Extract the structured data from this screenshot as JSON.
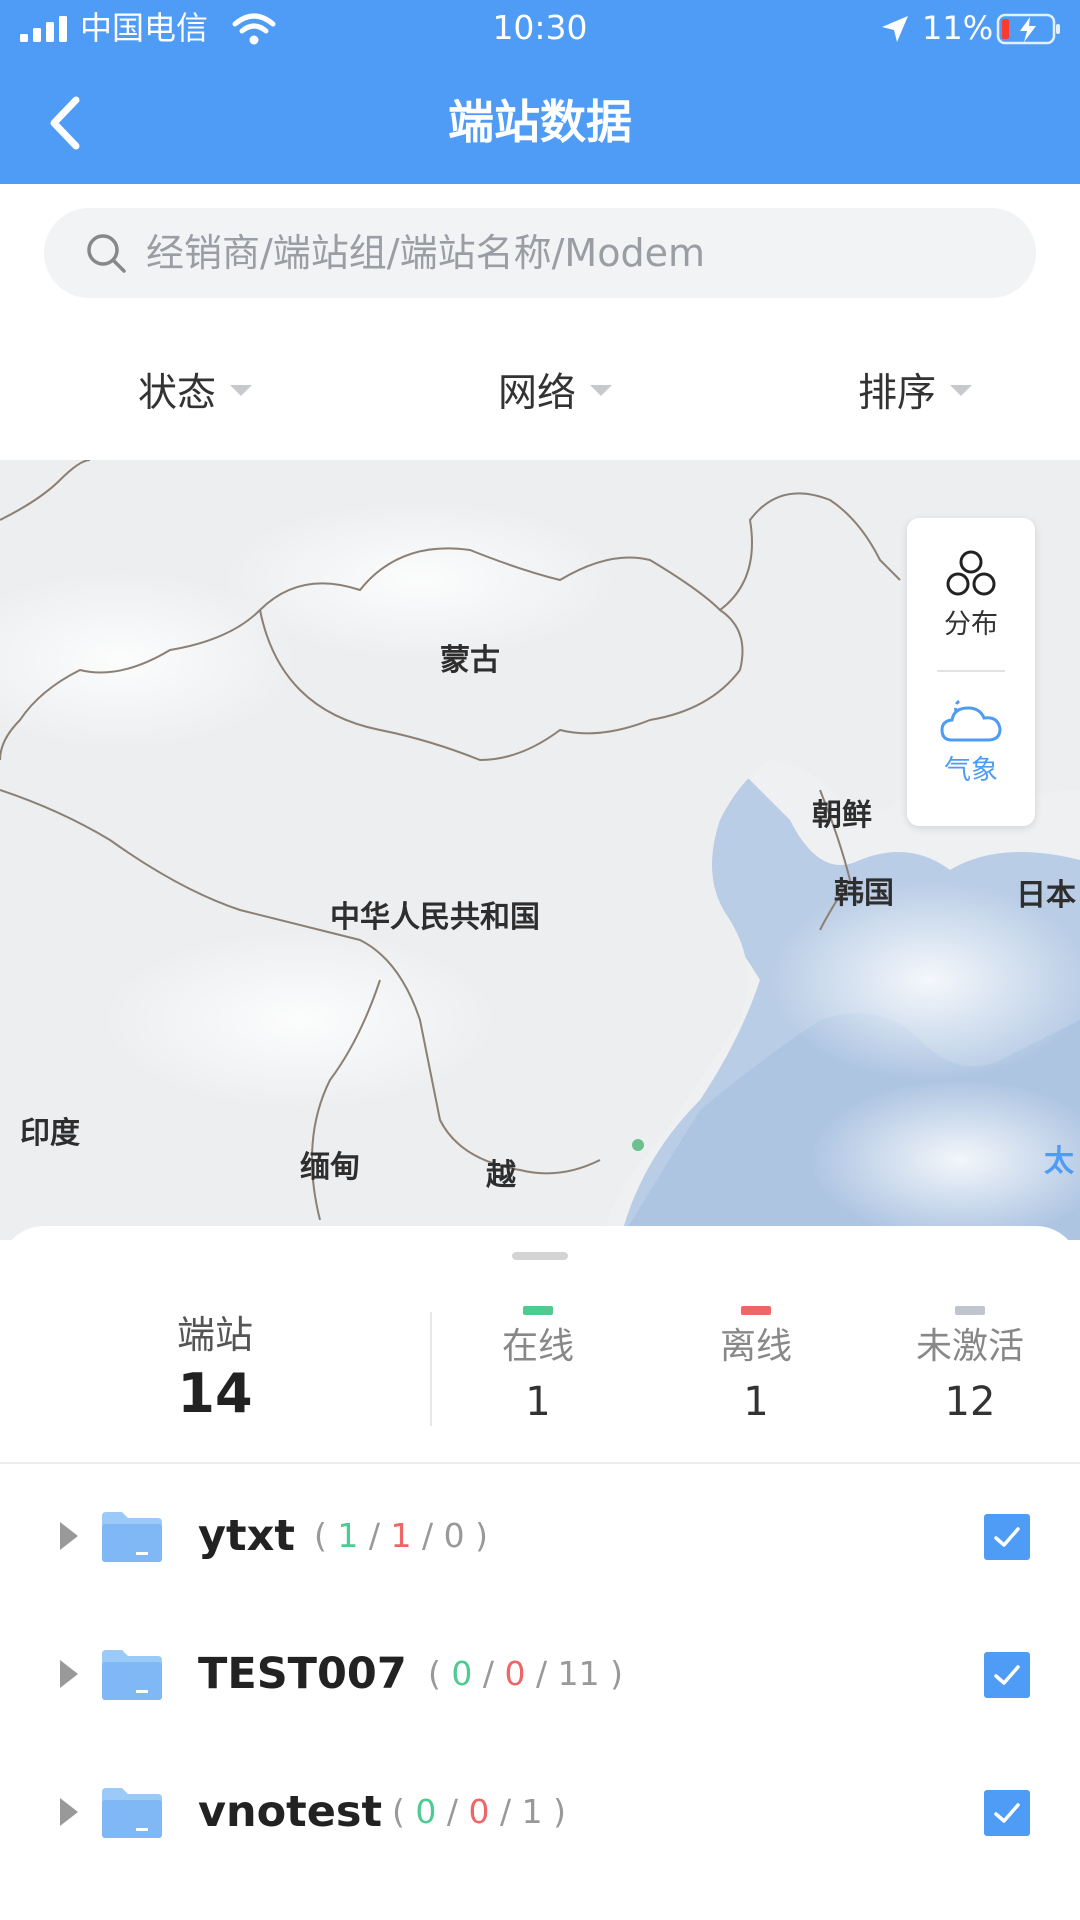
{
  "status_bar": {
    "carrier": "中国电信",
    "time": "10:30",
    "battery_percent": "11%"
  },
  "header": {
    "title": "端站数据",
    "background_color": "#4f9cf7"
  },
  "search": {
    "placeholder": "经销商/端站组/端站名称/Modem",
    "value": ""
  },
  "filters": [
    {
      "label": "状态"
    },
    {
      "label": "网络"
    },
    {
      "label": "排序"
    }
  ],
  "map": {
    "labels": [
      "蒙古",
      "朝鲜",
      "韩国",
      "日本",
      "中华人民共和国",
      "印度",
      "缅甸",
      "越",
      "太"
    ],
    "tools": [
      {
        "label": "分布",
        "icon": "distribution-icon"
      },
      {
        "label": "气象",
        "icon": "weather-icon",
        "active": true
      }
    ]
  },
  "summary": {
    "total_label": "端站",
    "total_value": "14",
    "stats": [
      {
        "label": "在线",
        "value": "1",
        "color": "#4ecb91"
      },
      {
        "label": "离线",
        "value": "1",
        "color": "#ee6666"
      },
      {
        "label": "未激活",
        "value": "12",
        "color": "#c0c4cc"
      }
    ]
  },
  "groups": [
    {
      "name": "ytxt",
      "online": "1",
      "offline": "1",
      "inactive": "0",
      "checked": true
    },
    {
      "name": "TEST007",
      "online": "0",
      "offline": "0",
      "inactive": "11",
      "checked": true
    },
    {
      "name": "vnotest",
      "online": "0",
      "offline": "0",
      "inactive": "1",
      "checked": true
    }
  ]
}
